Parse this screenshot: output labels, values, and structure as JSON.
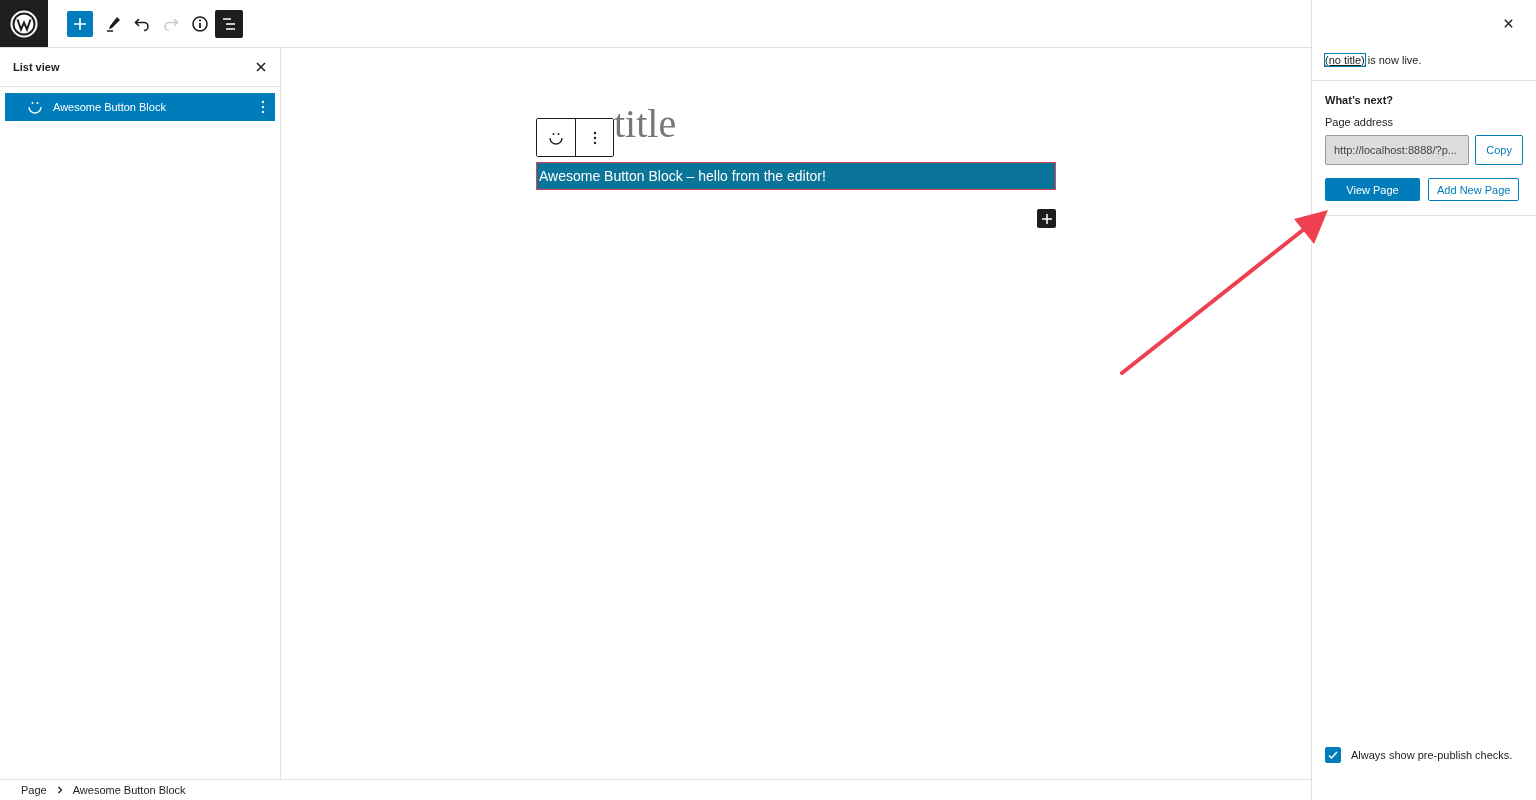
{
  "toolbar": [
    {
      "kind": "add",
      "disabled": false,
      "pressed": false
    },
    {
      "kind": "tools",
      "disabled": false,
      "pressed": false
    },
    {
      "kind": "undo",
      "disabled": false,
      "pressed": false
    },
    {
      "kind": "redo",
      "disabled": true,
      "pressed": false
    },
    {
      "kind": "info",
      "disabled": false,
      "pressed": false
    },
    {
      "kind": "list-view",
      "disabled": false,
      "pressed": true
    }
  ],
  "list_view": {
    "title": "List view",
    "items": [
      {
        "label": "Awesome Button Block",
        "selected": true
      }
    ]
  },
  "editor": {
    "title_placeholder": "title",
    "block_text": "Awesome Button Block – hello from the editor!"
  },
  "breadcrumb": [
    "Page",
    "Awesome Button Block"
  ],
  "post_publish": {
    "notice_link": "(no title)",
    "notice_text": "is now live.",
    "heading": "What’s next?",
    "address_label": "Page address",
    "address_value": "http://localhost:8888/?p...",
    "copy_button": "Copy",
    "view_button": "View Page",
    "add_new_button": "Add New Page",
    "checkbox": {
      "label": "Always show pre-publish checks.",
      "checked": true
    }
  }
}
